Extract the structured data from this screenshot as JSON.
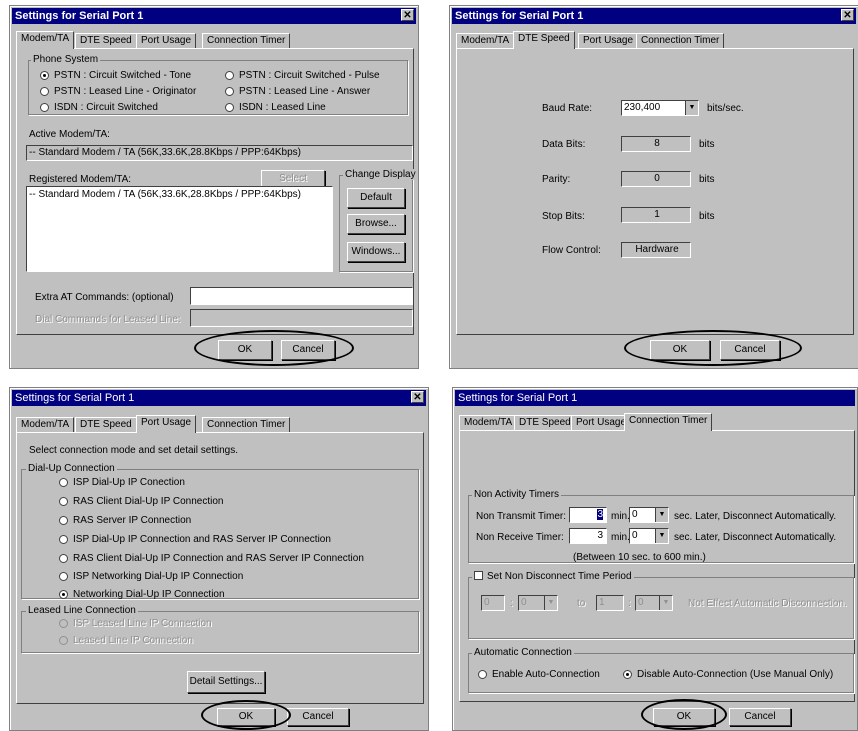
{
  "dialog1": {
    "title": "Settings for Serial Port 1",
    "tabs": [
      "Modem/TA",
      "DTE Speed",
      "Port Usage",
      "Connection Timer"
    ],
    "phone_system": {
      "label": "Phone System",
      "options": [
        "PSTN : Circuit Switched - Tone",
        "PSTN : Circuit Switched - Pulse",
        "PSTN : Leased Line - Originator",
        "PSTN : Leased Line - Answer",
        "ISDN : Circuit Switched",
        "ISDN : Leased Line"
      ]
    },
    "active_label": "Active Modem/TA:",
    "active_value": "-- Standard Modem / TA (56K,33.6K,28.8Kbps / PPP:64Kbps)",
    "registered_label": "Registered Modem/TA:",
    "select_button": "Select",
    "registered_item": "-- Standard Modem / TA (56K,33.6K,28.8Kbps / PPP:64Kbps)",
    "change_display": "Change Display",
    "default_button": "Default",
    "browse_button": "Browse...",
    "windows_button": "Windows...",
    "extra_at_label": "Extra AT Commands: (optional)",
    "dial_leased_label": "Dial Commands for Leased Line:",
    "ok": "OK",
    "cancel": "Cancel"
  },
  "dialog2": {
    "title": "Settings for Serial Port 1",
    "tabs": [
      "Modem/TA",
      "DTE Speed",
      "Port Usage",
      "Connection Timer"
    ],
    "baud_label": "Baud Rate:",
    "baud_value": "230,400",
    "baud_unit": "bits/sec.",
    "data_bits_label": "Data Bits:",
    "data_bits_value": "8",
    "parity_label": "Parity:",
    "parity_value": "0",
    "stop_bits_label": "Stop Bits:",
    "stop_bits_value": "1",
    "bits_unit": "bits",
    "flow_label": "Flow Control:",
    "flow_value": "Hardware",
    "ok": "OK",
    "cancel": "Cancel"
  },
  "dialog3": {
    "title": "Settings for Serial Port 1",
    "tabs": [
      "Modem/TA",
      "DTE Speed",
      "Port Usage",
      "Connection Timer"
    ],
    "instruction": "Select connection mode and set detail settings.",
    "dialup_label": "Dial-Up Connection",
    "dialup_options": [
      "ISP Dial-Up IP Conection",
      "RAS Client Dial-Up IP Connection",
      "RAS Server IP Connection",
      "ISP Dial-Up IP Connection and RAS Server IP Connection",
      "RAS Client Dial-Up IP Connection and RAS Server IP Connection",
      "ISP Networking Dial-Up IP Connection",
      "Networking Dial-Up IP Connection"
    ],
    "leased_label": "Leased Line Connection",
    "leased_options": [
      "ISP Leased Line IP Connection",
      "Leased Line IP Connection"
    ],
    "detail_button": "Detail Settings...",
    "ok": "OK",
    "cancel": "Cancel"
  },
  "dialog4": {
    "title": "Settings for Serial Port 1",
    "tabs": [
      "Modem/TA",
      "DTE Speed",
      "Port Usage",
      "Connection Timer"
    ],
    "timers_label": "Non Activity Timers",
    "transmit_label": "Non Transmit Timer:",
    "transmit_min": "3",
    "receive_label": "Non Receive Timer:",
    "receive_min": "3",
    "min_unit": "min.",
    "sec_value": "0",
    "sec_text": "sec. Later, Disconnect Automatically.",
    "range_note": "(Between 10 sec. to 600 min.)",
    "non_disconnect_label": "Set Non Disconnect Time Period",
    "period_start": "0",
    "period_end": "1",
    "period_sep": ":",
    "period_zero": "0",
    "to_text": "to",
    "not_effect": "Not Effect Automatic Disconnection.",
    "auto_label": "Automatic Connection",
    "enable_auto": "Enable Auto-Connection",
    "disable_auto": "Disable Auto-Connection (Use Manual Only)",
    "ok": "OK",
    "cancel": "Cancel"
  }
}
